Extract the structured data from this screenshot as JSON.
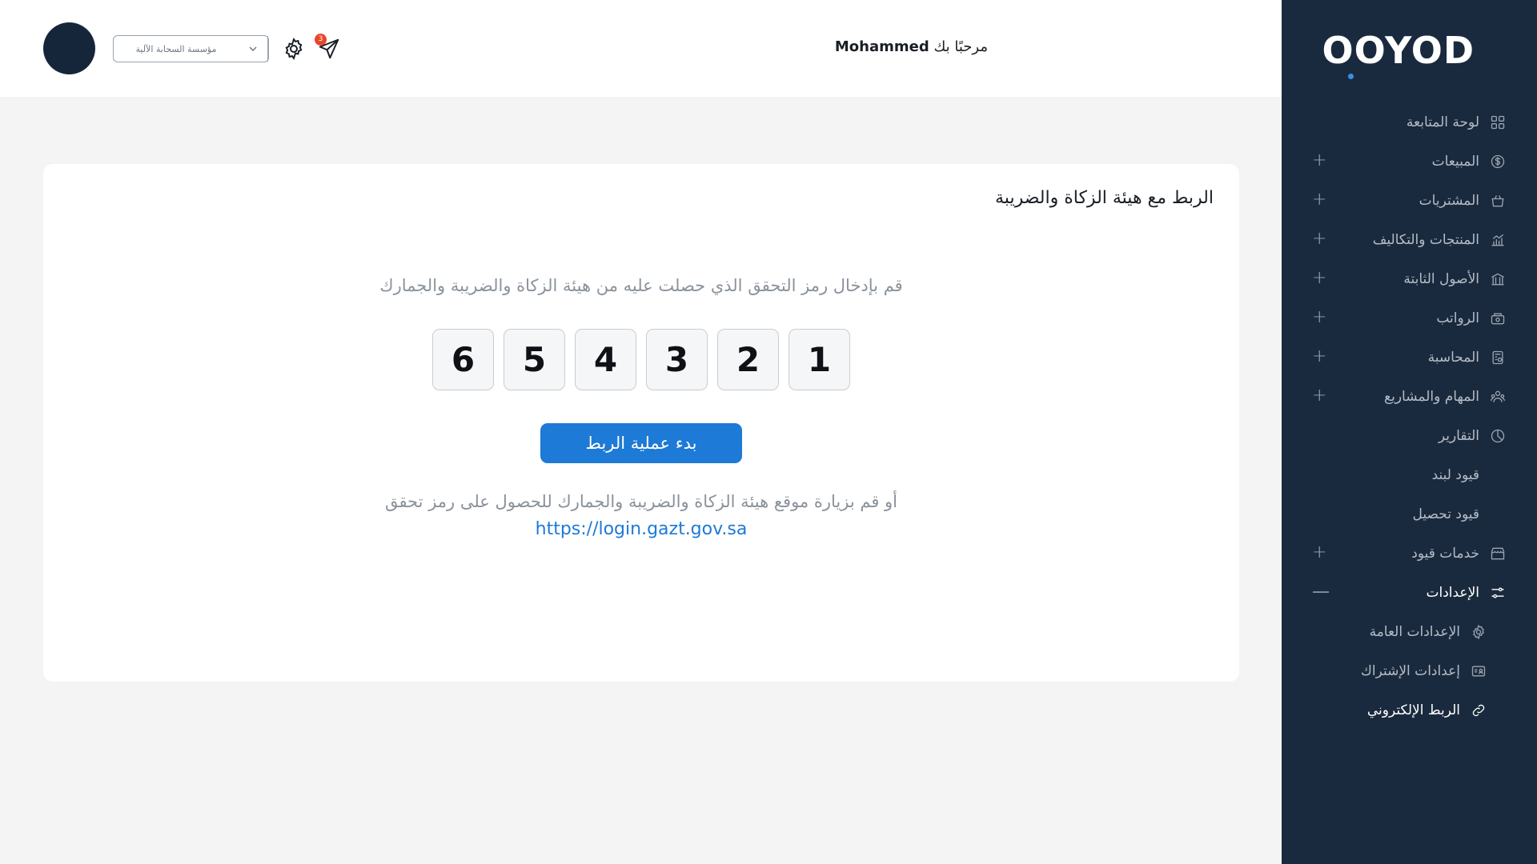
{
  "brand": {
    "logo_text": "OOYOD",
    "accent_color": "#3a8ee8",
    "sidebar_bg": "#1a2a3e"
  },
  "header": {
    "welcome_prefix": "مرحبًا بك",
    "user_name": "Mohammed",
    "org_select_value": "مؤسسة السحابة الآلية",
    "notification_count": "3"
  },
  "sidebar": {
    "items": [
      {
        "label": "لوحة المتابعة",
        "icon": "dashboard-icon",
        "plus": ""
      },
      {
        "label": "المبيعات",
        "icon": "dollar-icon",
        "plus": "+"
      },
      {
        "label": "المشتريات",
        "icon": "basket-icon",
        "plus": "+"
      },
      {
        "label": "المنتجات والتكاليف",
        "icon": "products-icon",
        "plus": "+"
      },
      {
        "label": "الأصول الثابتة",
        "icon": "building-icon",
        "plus": "+"
      },
      {
        "label": "الرواتب",
        "icon": "salary-icon",
        "plus": "+"
      },
      {
        "label": "المحاسبة",
        "icon": "accounting-icon",
        "plus": "+"
      },
      {
        "label": "المهام والمشاريع",
        "icon": "team-icon",
        "plus": "+"
      },
      {
        "label": "التقارير",
        "icon": "chart-icon",
        "plus": ""
      },
      {
        "label": "قيود لبند",
        "icon": "",
        "plus": ""
      },
      {
        "label": "قيود تحصيل",
        "icon": "",
        "plus": ""
      },
      {
        "label": "خدمات قيود",
        "icon": "store-icon",
        "plus": "+"
      },
      {
        "label": "الإعدادات",
        "icon": "sliders-icon",
        "plus": "—"
      }
    ],
    "settings_sub": [
      {
        "label": "الإعدادات العامة",
        "icon": "gear-icon"
      },
      {
        "label": "إعدادات الإشتراك",
        "icon": "id-card-icon"
      },
      {
        "label": "الربط الإلكتروني",
        "icon": "link-icon"
      }
    ]
  },
  "card": {
    "title": "الربط مع هيئة الزكاة والضريبة",
    "instruction": "قم بإدخال رمز التحقق الذي حصلت عليه من هيئة الزكاة والضريبة والجمارك",
    "otp": [
      "6",
      "5",
      "4",
      "3",
      "2",
      "1"
    ],
    "button_label": "بدء عملية الربط",
    "alt_text": "أو قم بزيارة موقع هيئة الزكاة والضريبة والجمارك للحصول على رمز تحقق",
    "link_text": "https://login.gazt.gov.sa"
  }
}
